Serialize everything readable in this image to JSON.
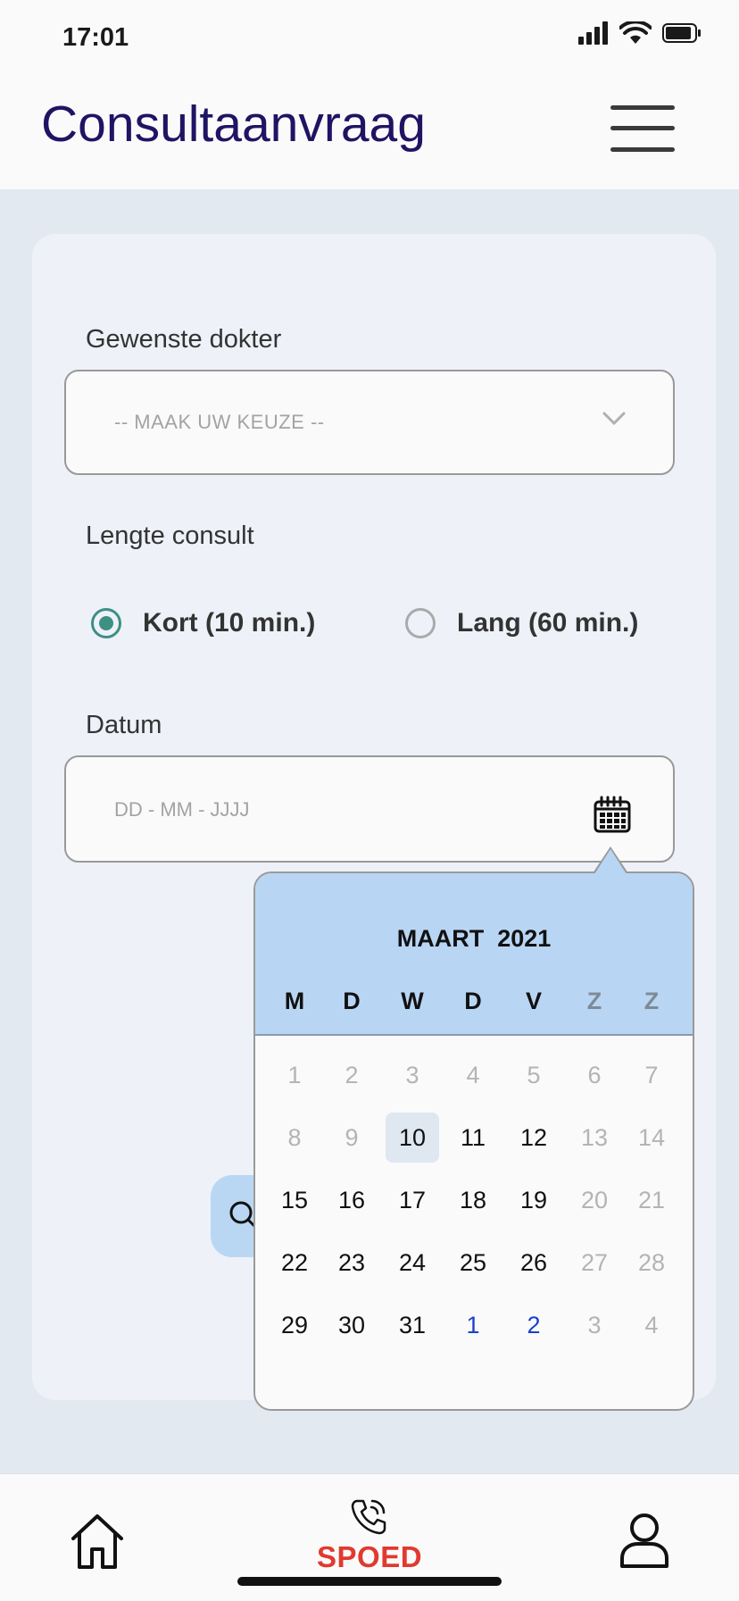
{
  "status_bar": {
    "time": "17:01",
    "icons": [
      "cellular-signal-icon",
      "wifi-icon",
      "battery-icon"
    ]
  },
  "header": {
    "title": "Consultaanvraag",
    "menu_icon": "hamburger-menu-icon"
  },
  "form": {
    "doctor_label": "Gewenste dokter",
    "doctor_placeholder": "-- MAAK UW KEUZE --",
    "length_label": "Lengte consult",
    "options": [
      {
        "label": "Kort (10 min.)",
        "selected": true
      },
      {
        "label": "Lang (60 min.)",
        "selected": false
      }
    ],
    "date_label": "Datum",
    "date_placeholder": "DD - MM - JJJJ",
    "search_icon": "search-icon"
  },
  "calendar": {
    "month": "MAART",
    "year": "2021",
    "weekdays": [
      "M",
      "D",
      "W",
      "D",
      "V",
      "Z",
      "Z"
    ],
    "selected_day": "10",
    "weeks": [
      [
        "1",
        "2",
        "3",
        "4",
        "5",
        "6",
        "7"
      ],
      [
        "8",
        "9",
        "10",
        "11",
        "12",
        "13",
        "14"
      ],
      [
        "15",
        "16",
        "17",
        "18",
        "19",
        "20",
        "21"
      ],
      [
        "22",
        "23",
        "24",
        "25",
        "26",
        "27",
        "28"
      ],
      [
        "29",
        "30",
        "31",
        "1",
        "2",
        "3",
        "4"
      ]
    ],
    "states": [
      [
        "muted",
        "muted",
        "muted",
        "muted",
        "muted",
        "muted",
        "muted"
      ],
      [
        "muted",
        "muted",
        "selected",
        "",
        "",
        "muted",
        "muted"
      ],
      [
        "",
        "",
        "",
        "",
        "",
        "muted",
        "muted"
      ],
      [
        "",
        "",
        "",
        "",
        "",
        "muted",
        "muted"
      ],
      [
        "",
        "",
        "",
        "next",
        "next",
        "muted",
        "muted"
      ]
    ]
  },
  "bottom_nav": {
    "home_icon": "home-icon",
    "emergency_icon": "phone-call-icon",
    "emergency_label": "SPOED",
    "profile_icon": "user-icon"
  },
  "colors": {
    "title": "#1f1463",
    "accent_radio": "#3e8f84",
    "calendar_header": "#b8d5f4",
    "emergency": "#e03a2f",
    "next_month_day": "#1a3fd0"
  }
}
